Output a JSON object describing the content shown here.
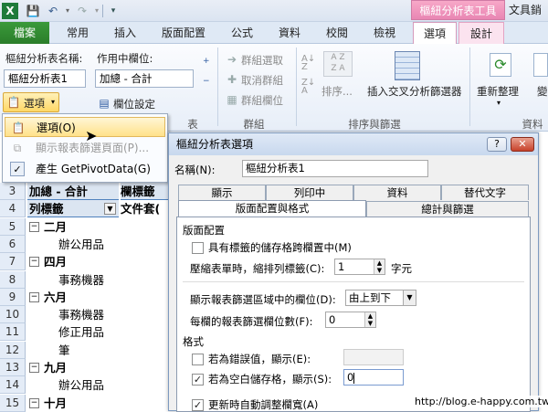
{
  "window": {
    "contextual_group": "樞紐分析表工具",
    "doc_title": "文具銷"
  },
  "quick_access": {
    "save_icon": "save-icon",
    "undo_icon": "undo-icon",
    "redo_icon": "redo-icon",
    "customize": "▾"
  },
  "tabs": {
    "file": "檔案",
    "home": "常用",
    "insert": "插入",
    "page_layout": "版面配置",
    "formulas": "公式",
    "data": "資料",
    "review": "校閱",
    "view": "檢視",
    "options": "選項",
    "design": "設計"
  },
  "ribbon": {
    "pt_name_label": "樞紐分析表名稱:",
    "pt_name_value": "樞紐分析表1",
    "options_button": "選項",
    "active_field_label": "作用中欄位:",
    "active_field_value": "加總 - 合計",
    "field_settings": "欄位設定",
    "group_selection": "群組選取",
    "ungroup": "取消群組",
    "group_field": "群組欄位",
    "group_label": "群組",
    "sort": "排序...",
    "sort_group_label": "排序與篩選",
    "insert_slicer": "插入交叉分析篩選器",
    "refresh": "重新整理",
    "change_source_partial": "變",
    "data_group_label": "資料",
    "pt_group_partial": "表"
  },
  "options_menu": {
    "options": "選項(O)",
    "show_report_filter_pages": "顯示報表篩選頁面(P)...",
    "generate_getpivotdata": "產生 GetPivotData(G)"
  },
  "sheet": {
    "rows": [
      {
        "num": "3",
        "a": "加總 - 合計",
        "b": "欄標籤"
      },
      {
        "num": "4",
        "a": "列標籤",
        "b": "文件套("
      },
      {
        "num": "5",
        "a": "二月",
        "b": ""
      },
      {
        "num": "6",
        "a": "辦公用品",
        "b": ""
      },
      {
        "num": "7",
        "a": "四月",
        "b": ""
      },
      {
        "num": "8",
        "a": "事務機器",
        "b": ""
      },
      {
        "num": "9",
        "a": "六月",
        "b": ""
      },
      {
        "num": "10",
        "a": "事務機器",
        "b": ""
      },
      {
        "num": "11",
        "a": "修正用品",
        "b": ""
      },
      {
        "num": "12",
        "a": "筆",
        "b": ""
      },
      {
        "num": "13",
        "a": "九月",
        "b": ""
      },
      {
        "num": "14",
        "a": "辦公用品",
        "b": ""
      },
      {
        "num": "15",
        "a": "十月",
        "b": ""
      }
    ]
  },
  "dialog": {
    "title": "樞紐分析表選項",
    "help": "?",
    "close": "✕",
    "name_label": "名稱(N):",
    "name_value": "樞紐分析表1",
    "tabs_row1": [
      "顯示",
      "列印中",
      "資料",
      "替代文字"
    ],
    "tabs_row2": [
      "版面配置與格式",
      "總計與篩選"
    ],
    "layout_section": "版面配置",
    "merge_center": "具有標籤的儲存格跨欄置中(M)",
    "compact_indent_label": "壓縮表單時，縮排列標籤(C):",
    "compact_indent_value": "1",
    "indent_unit": "字元",
    "filter_order_label": "顯示報表篩選區域中的欄位(D):",
    "filter_order_value": "由上到下",
    "filter_per_col_label": "每欄的報表篩選欄位數(F):",
    "filter_per_col_value": "0",
    "format_section": "格式",
    "error_show": "若為錯誤值，顯示(E):",
    "error_value": "",
    "empty_show": "若為空白儲存格，顯示(S):",
    "empty_value": "0",
    "autofit": "更新時自動調整欄寬(A)"
  },
  "watermark": "http://blog.e-happy.com.tw"
}
